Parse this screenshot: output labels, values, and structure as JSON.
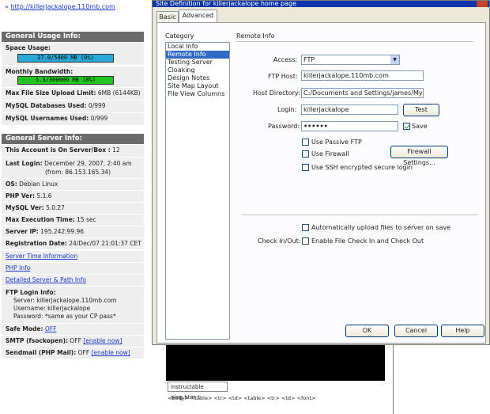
{
  "left_panel": {
    "top_link": "http://killerjackalope.110mb.com",
    "usage": {
      "header": "General Usage Info:",
      "space_label": "Space Usage:",
      "space_value": "27.0/5000 MB (0%)",
      "space_fraction": 0.005,
      "bandwidth_label": "Monthly Bandwidth:",
      "bandwidth_value": "5.3/300000 MB (0%)",
      "bandwidth_fraction": 0.0,
      "rows": [
        {
          "label": "Max File Size Upload Limit:",
          "value": "6MB (6144KB)"
        },
        {
          "label": "MySQL Databases Used:",
          "value": "0/999"
        },
        {
          "label": "MySQL Usernames Used:",
          "value": "0/999"
        }
      ]
    },
    "server": {
      "header": "General Server Info:",
      "box_label": "This Account is On Server/Box :",
      "box_value": "12",
      "last_login_label": "Last Login:",
      "last_login_value": "December 29, 2007, 2:40 am",
      "last_login_from": "(from: 86.153.165.34)",
      "os_label": "OS:",
      "os_value": "Debian Linux",
      "php_label": "PHP Ver:",
      "php_value": "5.1.6",
      "mysql_label": "MySQL Ver:",
      "mysql_value": "5.0.27",
      "exec_label": "Max Execution Time:",
      "exec_value": "15 sec",
      "ip_label": "Server IP:",
      "ip_value": "195.242.99.96",
      "reg_label": "Registration Date:",
      "reg_value": "24/Dec/07 21:01:37 CET",
      "link_time": "Server Time Information",
      "link_php": "PHP Info",
      "link_path": "Detailed Server & Path Info",
      "ftp_label": "FTP Login Info:",
      "ftp_server": "Server: killerjackalope.110mb.com",
      "ftp_user": "Username: killerjackalope",
      "ftp_pass": "Password: *same as your CP pass*",
      "safe_label": "Safe Mode:",
      "safe_value": "OFF",
      "smtp_label": "SMTP (fsockopen):",
      "smtp_value": "OFF",
      "smtp_link": "[enable now]",
      "sendmail_label": "Sendmail (PHP Mail):",
      "sendmail_value": "OFF",
      "sendmail_link": "[enable now]"
    }
  },
  "dialog": {
    "title": "Site Definition for killerjackalope home page",
    "tabs": [
      "Basic",
      "Advanced"
    ],
    "category_label": "Category",
    "categories": [
      "Local Info",
      "Remote Info",
      "Testing Server",
      "Cloaking",
      "Design Notes",
      "Site Map Layout",
      "File View Columns"
    ],
    "section_title": "Remote Info",
    "access_label": "Access:",
    "access_value": "FTP",
    "host_label": "FTP Host:",
    "host_value": "killerjackalope.110mb.com",
    "dir_label": "Host Directory:",
    "dir_value": "C:/Documents and Settings/james/My Do",
    "login_label": "Login:",
    "login_value": "killerjackalope",
    "test_button": "Test",
    "password_label": "Password:",
    "password_value": "••••••",
    "save_label": "Save",
    "passive_label": "Use Passive FTP",
    "firewall_label": "Use Firewall",
    "firewall_button": "Firewall Settings...",
    "ssh_label": "Use SSH encrypted secure login",
    "auto_upload_label": "Automatically upload files to server on save",
    "checkinout_label": "Check In/Out:",
    "checkinout_option": "Enable File Check In and Check Out",
    "ok_button": "OK",
    "cancel_button": "Cancel",
    "help_button": "Help"
  },
  "editor": {
    "doc_tab": "instructable oleg.htm *",
    "tag_bar": "<body> <table> <tr> <td> <table> <tr> <td> <font>"
  }
}
